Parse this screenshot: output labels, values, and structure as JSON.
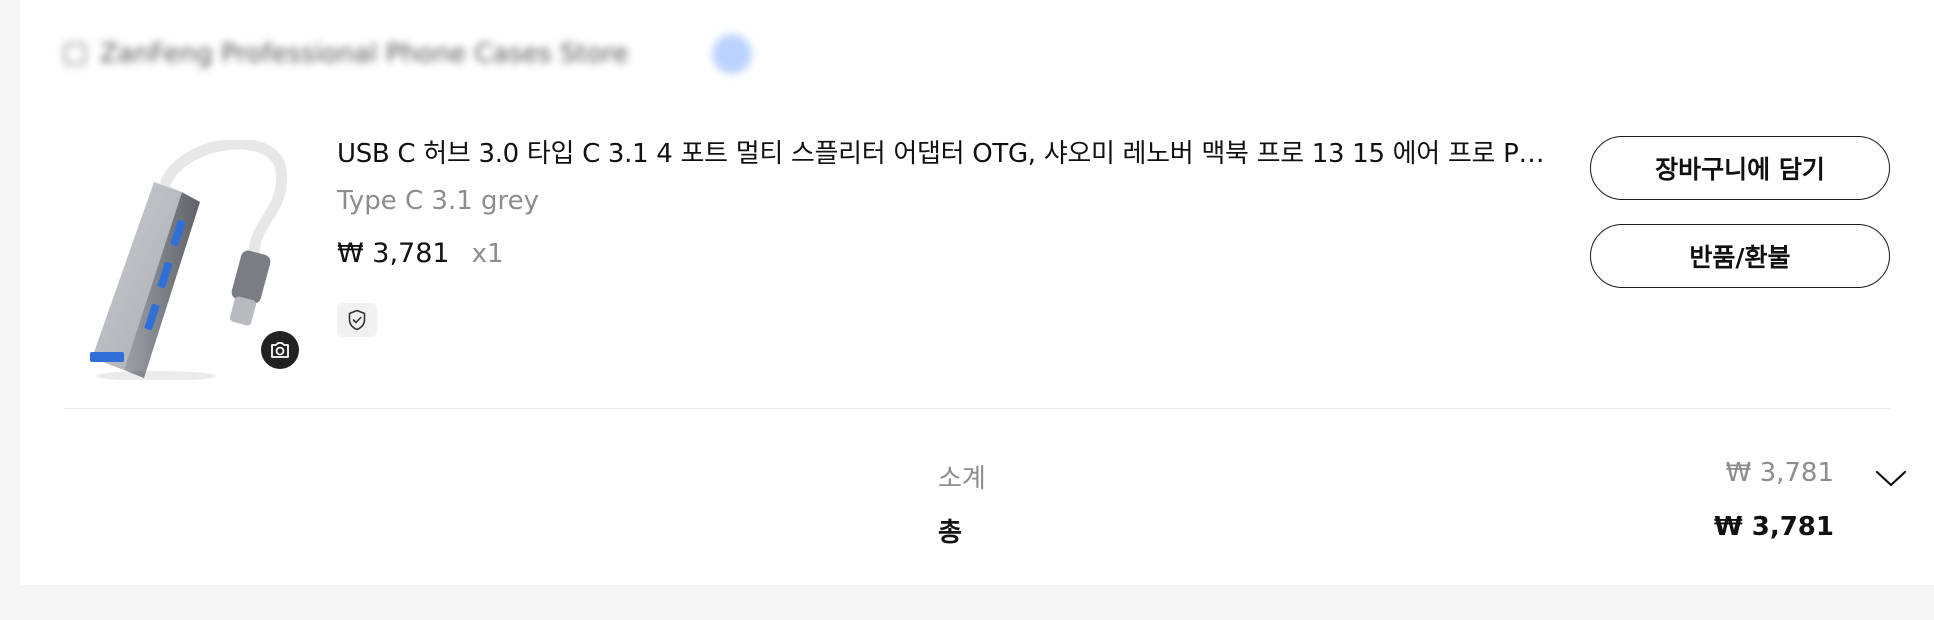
{
  "store": {
    "name": "ZanFeng Professional Phone Cases Store"
  },
  "product": {
    "title": "USB C 허브 3.0 타입 C 3.1 4 포트 멀티 스플리터 어댑터 OTG, 샤오미 레노버 맥북 프로 13 15 에어 프로 PC 컴퓨터 액세서리용",
    "variant": "Type C 3.1 grey",
    "price": "₩ 3,781",
    "quantity": "x1",
    "image_icon": "usb-hub-product-image",
    "badge_icon": "shield-check-icon",
    "camera_icon": "camera-icon"
  },
  "actions": {
    "add_to_cart": "장바구니에 담기",
    "return_refund": "반품/환불"
  },
  "summary": {
    "subtotal_label": "소계",
    "subtotal_value": "₩ 3,781",
    "total_label": "총",
    "total_value": "₩ 3,781",
    "expand_icon": "chevron-down-icon"
  },
  "colors": {
    "page_bg": "#f5f5f5",
    "card_bg": "#ffffff",
    "text_primary": "#111111",
    "text_secondary": "#8d8d8d",
    "camera_bg": "#222222"
  }
}
